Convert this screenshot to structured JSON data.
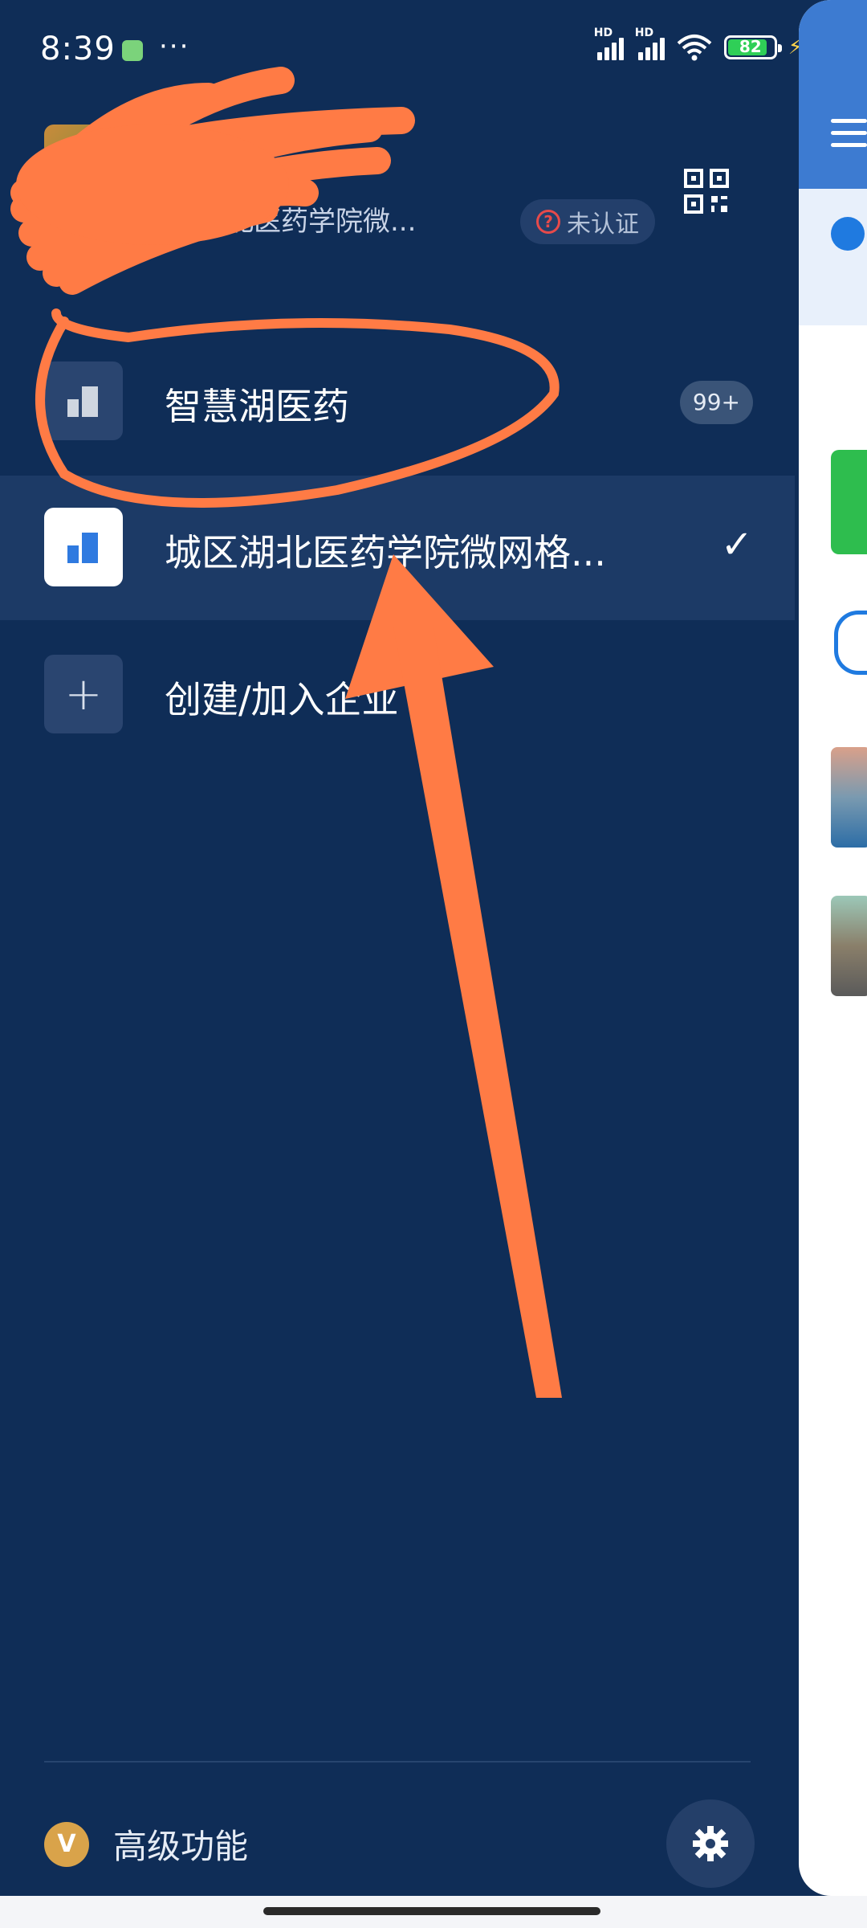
{
  "status_bar": {
    "time": "8:39",
    "more": "···",
    "signal_1": "HD",
    "signal_2": "HD",
    "battery": "82"
  },
  "profile": {
    "name_visible_part": "",
    "org_line": "城区湖北医药学院微...",
    "verification_status": "未认证"
  },
  "orgs": [
    {
      "label": "智慧湖医药",
      "badge": "99+",
      "selected": false
    },
    {
      "label": "城区湖北医药学院微网格...",
      "selected": true
    },
    {
      "label": "创建/加入企业"
    }
  ],
  "footer": {
    "premium_label": "高级功能"
  },
  "colors": {
    "background": "#0f2d57",
    "selected_row": "#1c3a66",
    "annotation": "#ff7b45",
    "peek_header": "#3d7bd1"
  }
}
